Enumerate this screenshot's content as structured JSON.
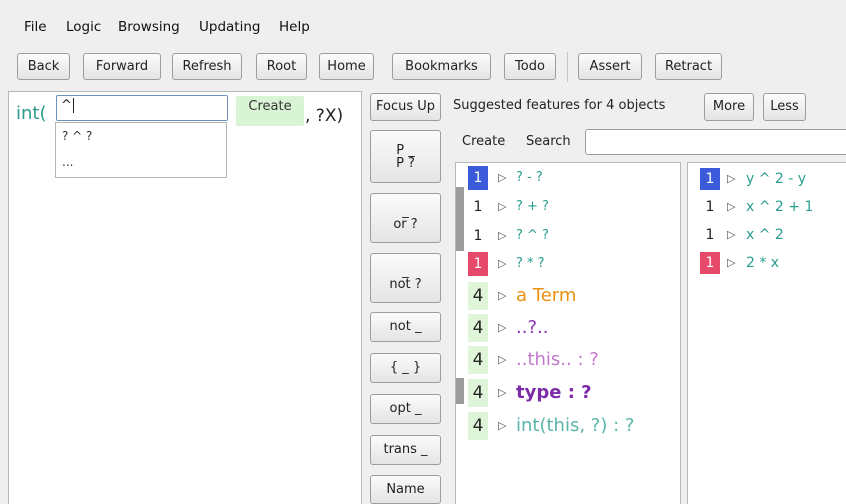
{
  "menu": [
    "File",
    "Logic",
    "Browsing",
    "Updating",
    "Help"
  ],
  "toolbar": {
    "back": "Back",
    "forward": "Forward",
    "refresh": "Refresh",
    "root": "Root",
    "home": "Home",
    "bookmarks": "Bookmarks",
    "todo": "Todo",
    "assert": "Assert",
    "retract": "Retract"
  },
  "query": {
    "prefix": "int(",
    "input_value": "^",
    "create_label": "Create",
    "suffix": ", ?X)",
    "dropdown": [
      "? ^ ?",
      "..."
    ]
  },
  "ops": {
    "focus_up": "Focus Up",
    "p_top": "P _",
    "p_bottom": "P ?",
    "or_top": "_",
    "or_bottom": "or ?",
    "not_top": "_",
    "not_bottom": "not ?",
    "not_prefix": "not _",
    "braces": "{ _ }",
    "opt": "opt _",
    "trans": "trans _",
    "name": "Name"
  },
  "features": {
    "suggested_prefix": "Suggested features for",
    "count": "4",
    "suggested_suffix": "objects",
    "more": "More",
    "less": "Less",
    "tab_create": "Create",
    "tab_search": "Search",
    "search_value": "",
    "items": [
      {
        "count": "1",
        "label": "? - ?",
        "count_bg": "#3b5bdb",
        "count_color": "#ffffff",
        "label_color": "#2a9d8f",
        "size": 13
      },
      {
        "count": "1",
        "label": "? + ?",
        "count_bg": "#ffffff",
        "count_color": "#222222",
        "label_color": "#2a9d8f",
        "size": 13
      },
      {
        "count": "1",
        "label": "? ^ ?",
        "count_bg": "#ffffff",
        "count_color": "#222222",
        "label_color": "#2a9d8f",
        "size": 13
      },
      {
        "count": "1",
        "label": "? * ?",
        "count_bg": "#e64969",
        "count_color": "#ffffff",
        "label_color": "#2a9d8f",
        "size": 13
      },
      {
        "count": "4",
        "label": "a Term",
        "count_bg": "#dff5da",
        "count_color": "#222222",
        "label_color": "#e8900f",
        "size": 18
      },
      {
        "count": "4",
        "label": "..?..",
        "count_bg": "#dff5da",
        "count_color": "#222222",
        "label_color": "#8a33b5",
        "size": 18
      },
      {
        "count": "4",
        "label": "..this.. : ?",
        "count_bg": "#dff5da",
        "count_color": "#222222",
        "label_color": "#c477cf",
        "size": 18
      },
      {
        "count": "4",
        "label": "type  : ?",
        "count_bg": "#dff5da",
        "count_color": "#222222",
        "label_color": "#7b2aa8",
        "size": 18
      },
      {
        "count": "4",
        "label": "int(this, ?) : ?",
        "count_bg": "#dff5da",
        "count_color": "#222222",
        "label_color": "#5ab5a8",
        "size": 18
      }
    ]
  },
  "objects": [
    {
      "count": "1",
      "label": "y ^ 2 - y",
      "count_bg": "#3b5bdb",
      "count_color": "#ffffff"
    },
    {
      "count": "1",
      "label": "x ^ 2 + 1",
      "count_bg": "#ffffff",
      "count_color": "#222222"
    },
    {
      "count": "1",
      "label": "x ^ 2",
      "count_bg": "#ffffff",
      "count_color": "#222222"
    },
    {
      "count": "1",
      "label": "2 * x",
      "count_bg": "#e64969",
      "count_color": "#ffffff"
    }
  ],
  "colors": {
    "term": "#2a9d8f",
    "selection_green": "#d9f4d4"
  }
}
